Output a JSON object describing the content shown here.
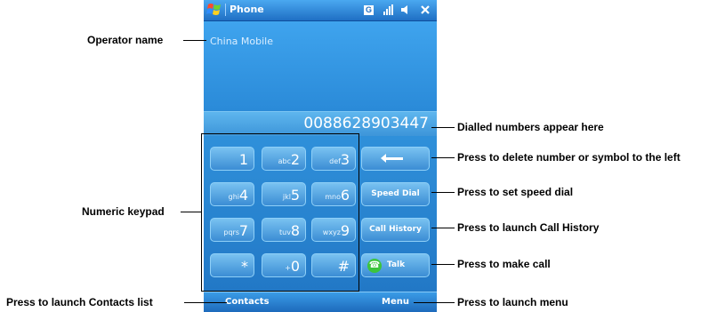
{
  "window": {
    "app_title": "Phone",
    "operator": "China Mobile",
    "dialled_number": "0088628903447"
  },
  "keypad": {
    "keys": [
      {
        "letters": "",
        "digit": "1"
      },
      {
        "letters": "abc",
        "digit": "2"
      },
      {
        "letters": "def",
        "digit": "3"
      },
      {
        "letters": "ghi",
        "digit": "4"
      },
      {
        "letters": "jkl",
        "digit": "5"
      },
      {
        "letters": "mno",
        "digit": "6"
      },
      {
        "letters": "pqrs",
        "digit": "7"
      },
      {
        "letters": "tuv",
        "digit": "8"
      },
      {
        "letters": "wxyz",
        "digit": "9"
      },
      {
        "letters": "",
        "digit": "*"
      },
      {
        "letters": "+",
        "digit": "0"
      },
      {
        "letters": "",
        "digit": "#"
      }
    ]
  },
  "function_keys": {
    "speed_dial": "Speed Dial",
    "call_history": "Call History",
    "talk": "Talk"
  },
  "softkeys": {
    "left": "Contacts",
    "right": "Menu"
  },
  "annotations": {
    "operator_name": "Operator name",
    "numeric_keypad": "Numeric keypad",
    "contacts": "Press to launch Contacts list",
    "dialled": "Dialled numbers appear here",
    "delete": "Press to delete number or symbol to the left",
    "speed_dial": "Press to set speed dial",
    "call_history": "Press to launch Call History",
    "talk": "Press to make call",
    "menu": "Press to launch menu"
  }
}
